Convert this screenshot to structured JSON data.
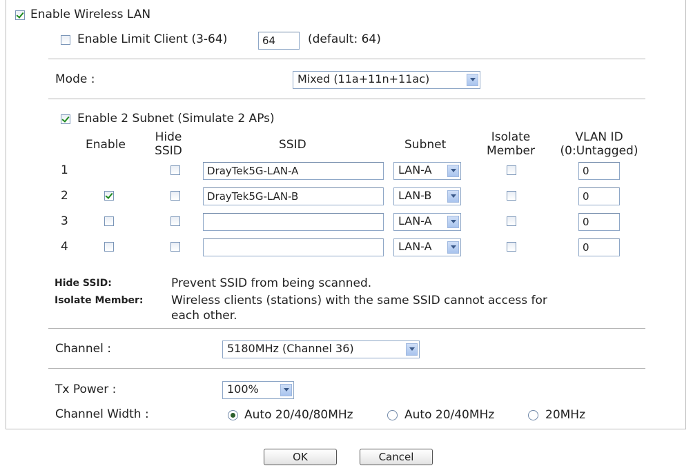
{
  "enable_wireless": {
    "label": "Enable Wireless LAN",
    "checked": true
  },
  "limit_client": {
    "label": "Enable Limit Client (3-64)",
    "value": "64",
    "hint": "(default: 64)",
    "checked": false
  },
  "mode": {
    "label": "Mode :",
    "value": "Mixed (11a+11n+11ac)"
  },
  "subnet": {
    "label": "Enable 2 Subnet (Simulate 2 APs)",
    "checked": true,
    "headers": {
      "enable": "Enable",
      "hide_l1": "Hide",
      "hide_l2": "SSID",
      "ssid": "SSID",
      "subnet": "Subnet",
      "iso_l1": "Isolate",
      "iso_l2": "Member",
      "vlan_l1": "VLAN ID",
      "vlan_l2": "(0:Untagged)"
    },
    "rows": [
      {
        "num": "1",
        "ssid": "DrayTek5G-LAN-A",
        "subnet": "LAN-A",
        "vlan": "0"
      },
      {
        "num": "2",
        "ssid": "DrayTek5G-LAN-B",
        "subnet": "LAN-B",
        "vlan": "0"
      },
      {
        "num": "3",
        "ssid": "",
        "subnet": "LAN-A",
        "vlan": "0"
      },
      {
        "num": "4",
        "ssid": "",
        "subnet": "LAN-A",
        "vlan": "0"
      }
    ]
  },
  "notes": {
    "hide_label": "Hide SSID:",
    "hide_text": "Prevent SSID from being scanned.",
    "iso_label": "Isolate Member:",
    "iso_text_1": "Wireless clients (stations) with the same SSID cannot access for",
    "iso_text_2": "each other."
  },
  "channel": {
    "label": "Channel :",
    "value": "5180MHz (Channel 36)"
  },
  "tx_power": {
    "label": "Tx Power :",
    "value": "100%"
  },
  "channel_width": {
    "label": "Channel Width :",
    "options": [
      "Auto 20/40/80MHz",
      "Auto 20/40MHz",
      "20MHz"
    ],
    "selected": "Auto 20/40/80MHz"
  },
  "buttons": {
    "ok": "OK",
    "cancel": "Cancel"
  },
  "colors": {
    "check": "#1d8a1d",
    "field_border": "#8ea7c7",
    "divider": "#b4b4b4"
  }
}
